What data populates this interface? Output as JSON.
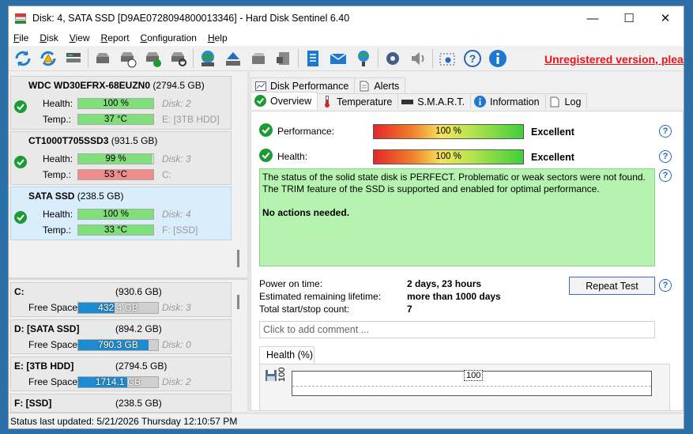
{
  "window": {
    "title": "Disk: 4, SATA SSD [D9AE0728094800013346]  -  Hard Disk Sentinel 6.40",
    "minimize": "—",
    "maximize": "☐",
    "close": "✕"
  },
  "menu": [
    {
      "key": "F",
      "rest": "ile"
    },
    {
      "key": "D",
      "rest": "isk"
    },
    {
      "key": "V",
      "rest": "iew"
    },
    {
      "key": "R",
      "rest": "eport"
    },
    {
      "key": "C",
      "rest": "onfiguration"
    },
    {
      "key": "H",
      "rest": "elp"
    }
  ],
  "toolbar": {
    "unregistered": "Unregistered version, please"
  },
  "disks": [
    {
      "name": "WDC WD30EFRX-68EUZN0",
      "size": "(2794.5 GB)",
      "health_label": "Health:",
      "health": "100 %",
      "health_pct": 100,
      "health_color": "#7fe07a",
      "temp_label": "Temp.:",
      "temp": "37 °C",
      "temp_color": "#7fe07a",
      "disk": "Disk: 2",
      "drive": "E: [3TB HDD]"
    },
    {
      "name": "CT1000T705SSD3",
      "size": "(931.5 GB)",
      "health_label": "Health:",
      "health": "99 %",
      "health_pct": 99,
      "health_color": "#7fe07a",
      "temp_label": "Temp.:",
      "temp": "53 °C",
      "temp_color": "#f08c8c",
      "disk": "Disk: 3",
      "drive": "C:"
    },
    {
      "name": "SATA SSD",
      "size": "(238.5 GB)",
      "health_label": "Health:",
      "health": "100 %",
      "health_pct": 100,
      "health_color": "#7fe07a",
      "temp_label": "Temp.:",
      "temp": "33 °C",
      "temp_color": "#7fe07a",
      "disk": "Disk: 4",
      "drive": "F: [SSD]"
    }
  ],
  "volumes": [
    {
      "name": "C:",
      "size": "(930.6 GB)",
      "free_label": "Free Space",
      "free": "432.4 GB",
      "used_pct": 54,
      "disk": "Disk: 3"
    },
    {
      "name": "D: [SATA SSD]",
      "size": "(894.2 GB)",
      "free_label": "Free Space",
      "free": "790.3 GB",
      "used_pct": 12,
      "disk": "Disk: 0"
    },
    {
      "name": "E: [3TB HDD]",
      "size": "(2794.5 GB)",
      "free_label": "Free Space",
      "free": "1714.1 GB",
      "used_pct": 39,
      "disk": "Disk: 2"
    },
    {
      "name": "F: [SSD]",
      "size": "(238.5 GB)"
    }
  ],
  "tabs_top": [
    "Disk Performance",
    "Alerts"
  ],
  "tabs_bottom": [
    "Overview",
    "Temperature",
    "S.M.A.R.T.",
    "Information",
    "Log"
  ],
  "overview": {
    "performance_label": "Performance:",
    "performance_value": "100 %",
    "performance_rating": "Excellent",
    "health_label": "Health:",
    "health_value": "100 %",
    "health_rating": "Excellent",
    "status_lines": [
      "The status of the solid state disk is PERFECT. Problematic or weak sectors were not found.",
      "The TRIM feature of the SSD is supported and enabled for optimal performance."
    ],
    "status_action": "No actions needed.",
    "power_on_label": "Power on time:",
    "power_on_value": "2 days, 23 hours",
    "lifetime_label": "Estimated remaining lifetime:",
    "lifetime_value": "more than 1000 days",
    "startstop_label": "Total start/stop count:",
    "startstop_value": "7",
    "repeat_test": "Repeat Test",
    "comment_placeholder": "Click to add comment ...",
    "graph_tab": "Health (%)",
    "graph_ylabel": "100",
    "graph_point_label": "100"
  },
  "status_bar": "Status last updated: 5/21/2026 Thursday 12:10:57 PM"
}
